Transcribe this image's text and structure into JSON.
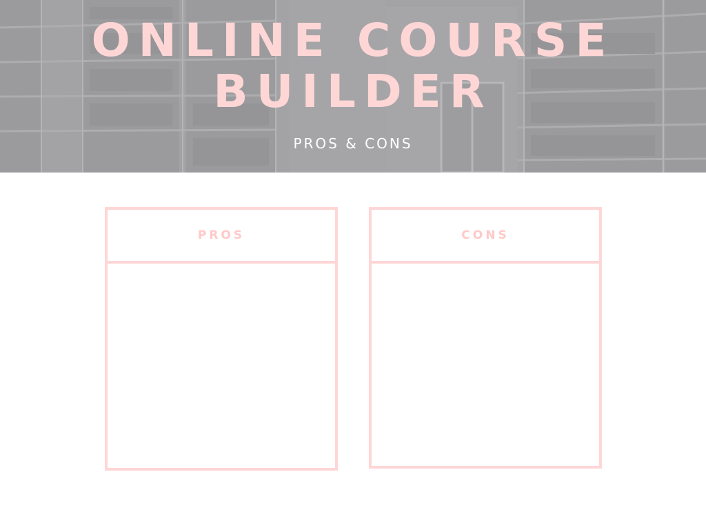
{
  "header": {
    "title_line1": "ONLINE COURSE",
    "title_line2": "BUILDER",
    "subtitle": "PROS & CONS"
  },
  "cards": {
    "pros": {
      "label": "PROS"
    },
    "cons": {
      "label": "CONS"
    }
  },
  "colors": {
    "accent_pink": "#ffd6d6",
    "hero_gray": "#a7a7a9",
    "subtitle_white": "#ffffff"
  }
}
